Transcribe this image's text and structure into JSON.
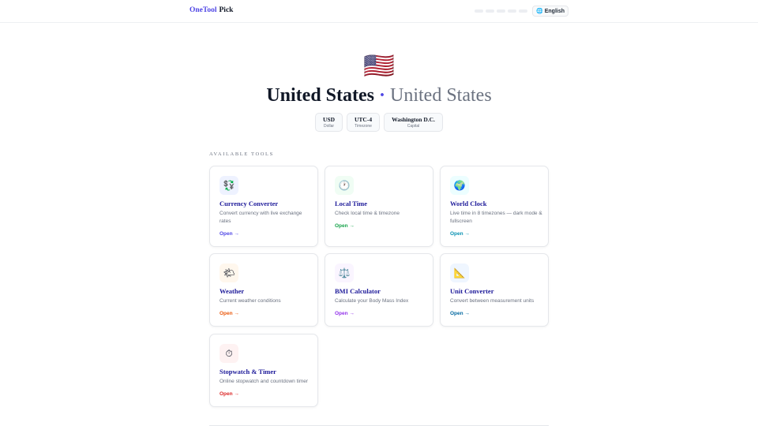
{
  "header": {
    "logo_part1": "OneTool",
    "logo_part2": "Pick",
    "language_icon": "globe-icon",
    "language_label": "English"
  },
  "hero": {
    "flag_icon": "us-flag-icon",
    "flag_glyph": "🇺🇸",
    "title": "United States",
    "separator": "·",
    "native_name": "United States"
  },
  "chips": [
    {
      "value": "USD",
      "label": "Dollar"
    },
    {
      "value": "UTC-4",
      "label": "Timezone"
    },
    {
      "value": "Washington D.C.",
      "label": "Capital"
    }
  ],
  "section_label": "AVAILABLE TOOLS",
  "tools": [
    {
      "icon": "currency-exchange-icon",
      "glyph": "💱",
      "icon_bg": "#eef2ff",
      "name": "Currency Converter",
      "description": "Convert currency with live exchange rates",
      "open_label": "Open →",
      "accent": "#4f46e5"
    },
    {
      "icon": "clock-icon",
      "glyph": "🕐",
      "icon_bg": "#f0fdf4",
      "name": "Local Time",
      "description": "Check local time & timezone",
      "open_label": "Open →",
      "accent": "#16a34a"
    },
    {
      "icon": "globe-icon",
      "glyph": "🌍",
      "icon_bg": "#ecfeff",
      "name": "World Clock",
      "description": "Live time in 8 timezones — dark mode & fullscreen",
      "open_label": "Open →",
      "accent": "#0891b2"
    },
    {
      "icon": "weather-icon",
      "glyph": "🌤",
      "icon_bg": "#fff7ed",
      "name": "Weather",
      "description": "Current weather conditions",
      "open_label": "Open →",
      "accent": "#ea580c"
    },
    {
      "icon": "scale-icon",
      "glyph": "⚖️",
      "icon_bg": "#faf5ff",
      "name": "BMI Calculator",
      "description": "Calculate your Body Mass Index",
      "open_label": "Open →",
      "accent": "#9333ea"
    },
    {
      "icon": "ruler-icon",
      "glyph": "📐",
      "icon_bg": "#eff6ff",
      "name": "Unit Converter",
      "description": "Convert between measurement units",
      "open_label": "Open →",
      "accent": "#0369a1"
    },
    {
      "icon": "stopwatch-icon",
      "glyph": "⏱",
      "icon_bg": "#fef2f2",
      "name": "Stopwatch & Timer",
      "description": "Online stopwatch and countdown timer",
      "open_label": "Open →",
      "accent": "#dc2626"
    }
  ]
}
